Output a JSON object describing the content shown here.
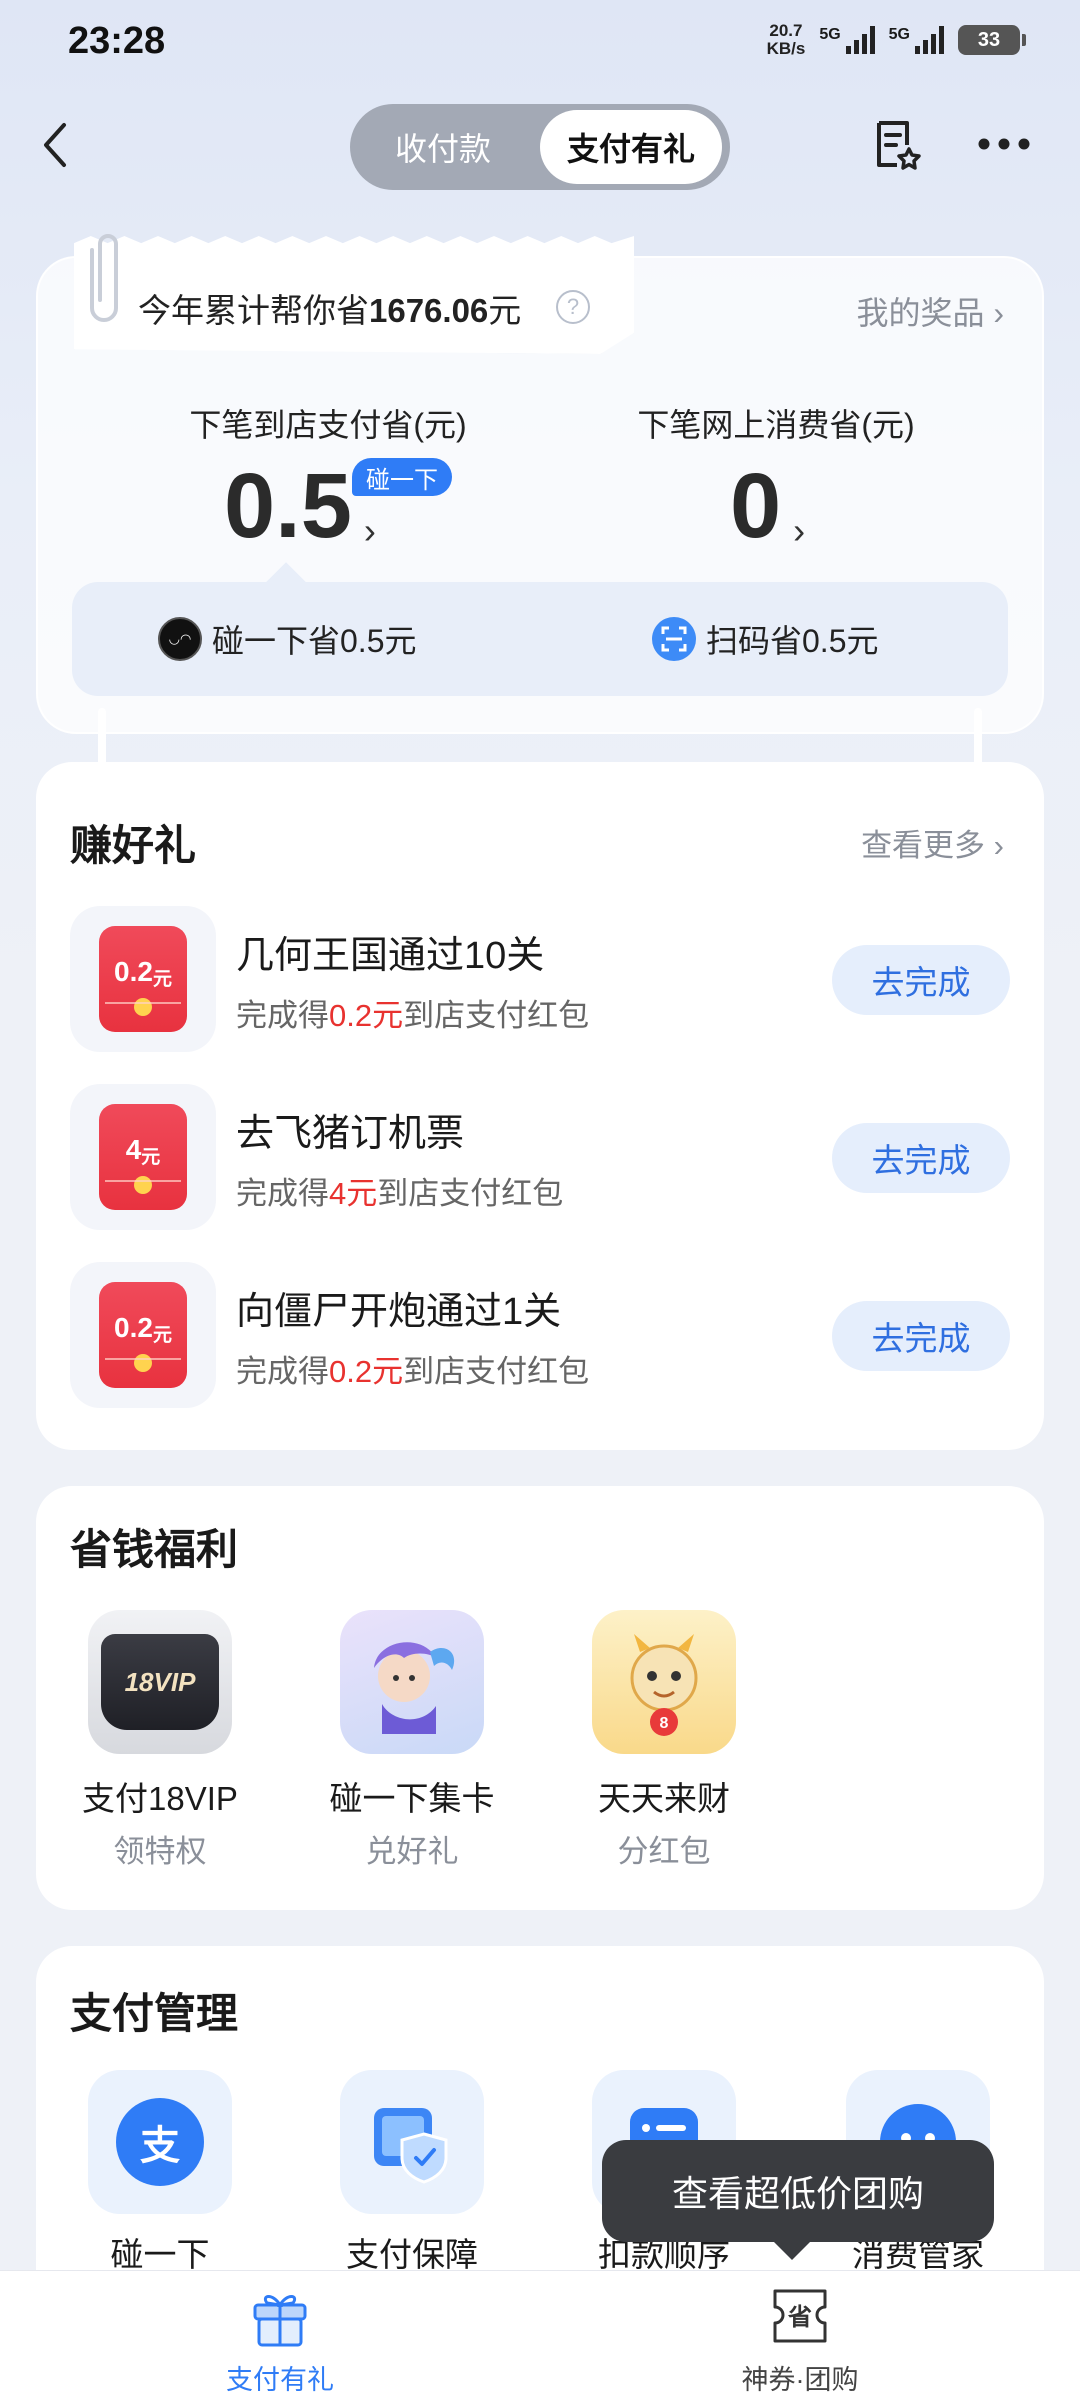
{
  "status_bar": {
    "time": "23:28",
    "net_speed_value": "20.7",
    "net_speed_unit": "KB/s",
    "signal1_label": "5G",
    "signal2_label": "5G",
    "battery": "33"
  },
  "header": {
    "segments": [
      "收付款",
      "支付有礼"
    ],
    "active_segment": "支付有礼"
  },
  "savings": {
    "total_prefix": "今年累计帮你省",
    "total_amount": "1676.06",
    "total_suffix": "元",
    "my_prizes": "我的奖品 ›",
    "store_label": "下笔到店支付省(元)",
    "store_value": "0.5",
    "store_badge": "碰一下",
    "online_label": "下笔网上消费省(元)",
    "online_value": "0",
    "arrow": "›",
    "methods": [
      {
        "label": "碰一下省0.5元",
        "icon": "nfc-icon"
      },
      {
        "label": "扫码省0.5元",
        "icon": "scan-icon"
      }
    ]
  },
  "earn": {
    "title": "赚好礼",
    "more": "查看更多 ›",
    "tasks": [
      {
        "title": "几何王国通过10关",
        "amount_num": "0.2",
        "amount_unit": "元",
        "sub_prefix": "完成得",
        "sub_amount": "0.2元",
        "sub_suffix": "到店支付红包",
        "button": "去完成"
      },
      {
        "title": "去飞猪订机票",
        "amount_num": "4",
        "amount_unit": "元",
        "sub_prefix": "完成得",
        "sub_amount": "4元",
        "sub_suffix": "到店支付红包",
        "button": "去完成"
      },
      {
        "title": "向僵尸开炮通过1关",
        "amount_num": "0.2",
        "amount_unit": "元",
        "sub_prefix": "完成得",
        "sub_amount": "0.2元",
        "sub_suffix": "到店支付红包",
        "button": "去完成"
      }
    ]
  },
  "benefits": {
    "title": "省钱福利",
    "items": [
      {
        "name": "支付18VIP",
        "sub": "领特权",
        "badge": "18VIP"
      },
      {
        "name": "碰一下集卡",
        "sub": "兑好礼"
      },
      {
        "name": "天天来财",
        "sub": "分红包",
        "badge": "8"
      }
    ]
  },
  "management": {
    "title": "支付管理",
    "items": [
      {
        "name": "碰一下",
        "icon_text": "支"
      },
      {
        "name": "支付保障"
      },
      {
        "name": "扣款顺序"
      },
      {
        "name": "消费管家"
      }
    ]
  },
  "tooltip": "查看超低价团购",
  "bottom_nav": {
    "tabs": [
      {
        "label": "支付有礼",
        "active": true
      },
      {
        "label": "神券·团购",
        "active": false,
        "icon_text": "省"
      }
    ]
  },
  "colors": {
    "accent": "#2f7cf6",
    "red": "#e8322f",
    "button_bg": "#e5eefc"
  }
}
